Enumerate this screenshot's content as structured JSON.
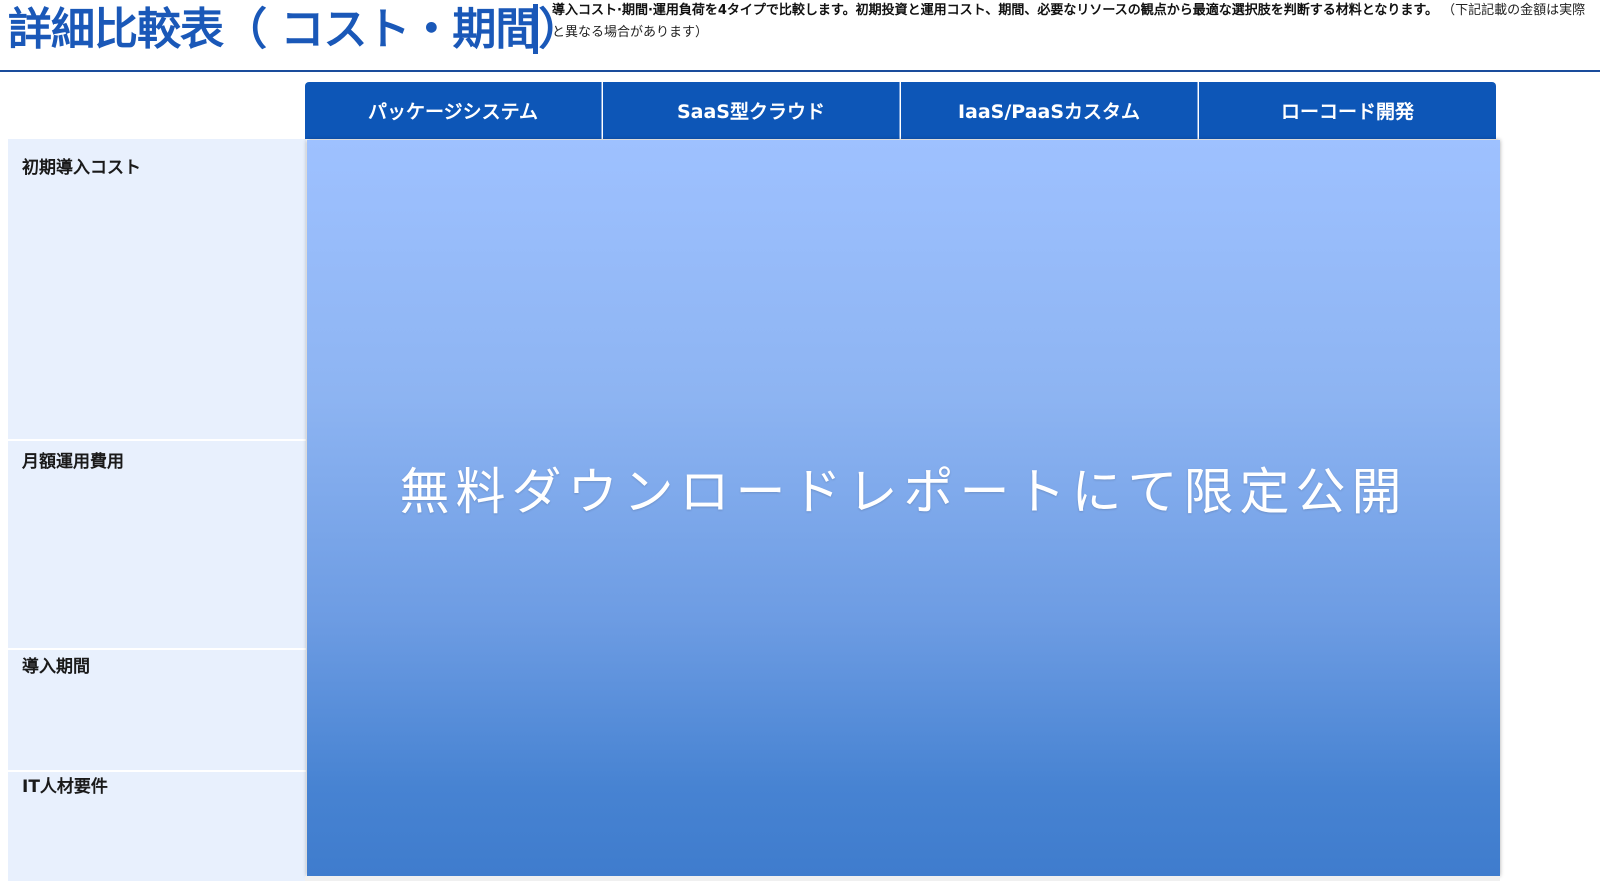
{
  "header": {
    "title": "詳細比較表（ コスト・期間）",
    "description_bold": "導入コスト·期間·運用負荷を4タイプで比較します。初期投資と運用コスト、期間、必要なリソースの観点から最適な選択肢を判断する材料となります。",
    "description_note": "（下記記載の金額は実際と異なる場合があります）"
  },
  "table": {
    "columns": [
      "パッケージシステム",
      "SaaS型クラウド",
      "IaaS/PaaSカスタム",
      "ローコード開発"
    ],
    "rows": [
      "初期導入コスト",
      "月額運用費用",
      "導入期間",
      "IT人材要件"
    ]
  },
  "overlay": {
    "text": "無料ダウンロードレポートにて限定公開"
  }
}
